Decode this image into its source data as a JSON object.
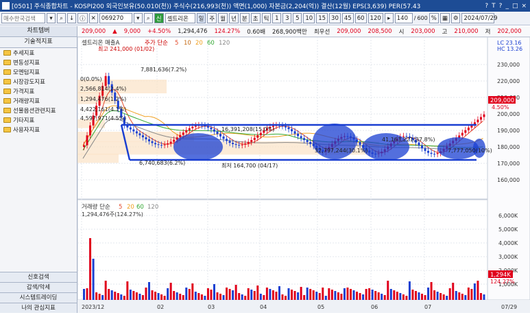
{
  "window": {
    "title": "[0501] 주식종합차트 - KOSPI200 외국인보유(50.010(천)) 주식수(216,993(천)) 액면(1,000) 자본금(2,204(억)) 결산(12월) EPS(3,639) PER(57.43",
    "controls": [
      "?",
      "T",
      "?",
      "_",
      "□",
      "×"
    ]
  },
  "toolbar": {
    "search_placeholder": "매수한국검색",
    "code": "069270",
    "name": "셀트리온",
    "period_buttons": [
      "일",
      "주",
      "월",
      "년",
      "분",
      "초",
      "틱",
      "1",
      "3",
      "5",
      "10",
      "15",
      "30",
      "45",
      "60",
      "120"
    ],
    "count": "140",
    "count_total": "600",
    "date": "2024/07/29"
  },
  "quote": {
    "price": "209,000",
    "change": "9,000",
    "change_pct": "+4.50%",
    "volume": "1,294,476",
    "volume_pct": "124.27%",
    "ratio": "0.60배",
    "amount": "268,900백만",
    "prefs": "최우선",
    "ask": "209,000",
    "bid": "208,500",
    "open_label": "시",
    "open": "203,000",
    "high_label": "고",
    "high": "210,000",
    "low_label": "저",
    "low": "202,000"
  },
  "sidebar": {
    "header": "차트템버",
    "section": "기술적지표",
    "items": [
      "추세지표",
      "변동성지표",
      "모멘텀지표",
      "시장강도지표",
      "가격지표",
      "거래량지표",
      "선물옵션관련지표",
      "기타지표",
      "사용자지표"
    ],
    "bottom_tabs": [
      "신호검색",
      "갑색/악세",
      "시스템트레이딩",
      "나의 관심지표"
    ]
  },
  "chart": {
    "legend": "셀트리온 매출A",
    "ma_label": "주가 단순",
    "ma_periods": [
      "5",
      "10",
      "20",
      "60",
      "120"
    ],
    "top_note": "최고 241,000 (01/02)",
    "annotations": [
      "7,881,636(7.2%)",
      "0(0.0%)",
      "2,566,814(2.4%)",
      "1,294,476(1.2%)",
      "4,422,161(4.1%)",
      "4,597,971(4.5%)",
      "16,391,208(15.0%)",
      "6,740,683(6.2%)",
      "32,797,244(30.1%)",
      "41,163,221(37.8%)",
      "7,777,050(10%)",
      "최저 164,700 (04/17)"
    ],
    "y_labels": [
      "230,000",
      "220,000",
      "210,000",
      "200,000",
      "190,000",
      "180,000",
      "170,000",
      "160,000"
    ],
    "y_top_note": "LC 23.16\nHC 13.26",
    "price_tag": "209,000",
    "price_tag_pct": "4.50%",
    "volume_legend": "거래량 단순",
    "volume_periods": [
      "5",
      "20",
      "60",
      "120"
    ],
    "volume_note": "1,294,476주(124.27%)",
    "vol_y_labels": [
      "6,000K",
      "5,000K",
      "4,000K",
      "3,000K",
      "2,000K",
      "1,000K"
    ],
    "vol_tag": "1,294K",
    "vol_tag_pct": "124.27%",
    "x_labels": [
      "2023/12",
      "02",
      "03",
      "04",
      "05",
      "06",
      "07"
    ],
    "x_end": "07/29"
  },
  "colors": {
    "up": "#e0001b",
    "down": "#1a3fd1",
    "ma5": "#e34a2b",
    "ma20": "#f0a020",
    "ma60": "#33a833",
    "ma120": "#888888"
  }
}
